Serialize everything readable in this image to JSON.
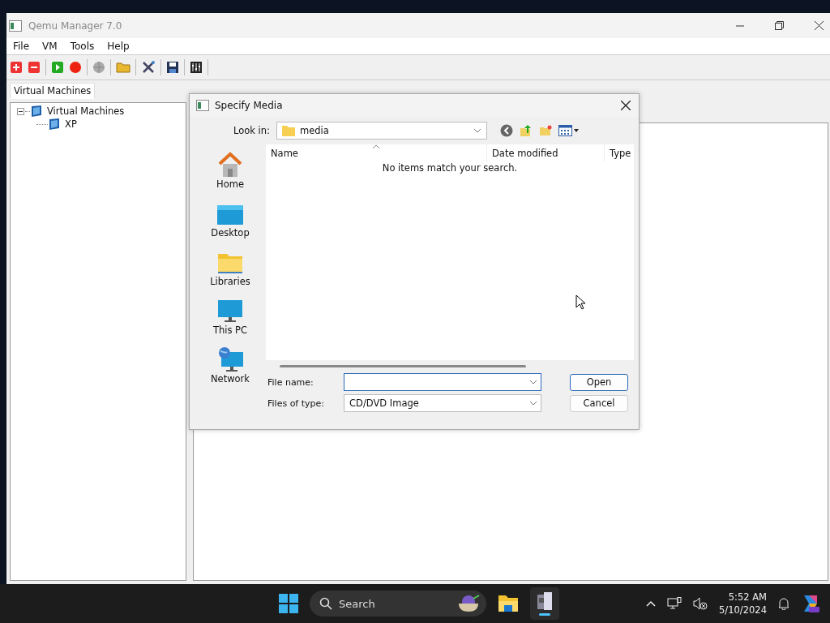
{
  "window": {
    "title": "Qemu Manager 7.0"
  },
  "menu": [
    "File",
    "VM",
    "Tools",
    "Help"
  ],
  "tabs": [
    {
      "label": "Virtual Machines",
      "selected": true
    }
  ],
  "tree": [
    {
      "label": "Virtual Machines",
      "expanded": true,
      "children": [
        {
          "label": "XP"
        }
      ]
    }
  ],
  "dialog": {
    "title": "Specify Media",
    "look_in_label": "Look in:",
    "look_in_value": "media",
    "places": [
      {
        "label": "Home",
        "kind": "home"
      },
      {
        "label": "Desktop",
        "kind": "desktop"
      },
      {
        "label": "Libraries",
        "kind": "libraries"
      },
      {
        "label": "This PC",
        "kind": "pc"
      },
      {
        "label": "Network",
        "kind": "network"
      }
    ],
    "columns": [
      "Name",
      "Date modified",
      "Type"
    ],
    "empty_message": "No items match your search.",
    "file_name_label": "File name:",
    "files_of_type_label": "Files of type:",
    "files_of_type_value": "CD/DVD Image",
    "buttons": [
      {
        "label": "Open",
        "kind": "default"
      },
      {
        "label": "Cancel",
        "kind": "normal"
      }
    ]
  },
  "taskbar": {
    "search_placeholder": "Search",
    "time": "5:52 AM",
    "date": "5/10/2024"
  }
}
